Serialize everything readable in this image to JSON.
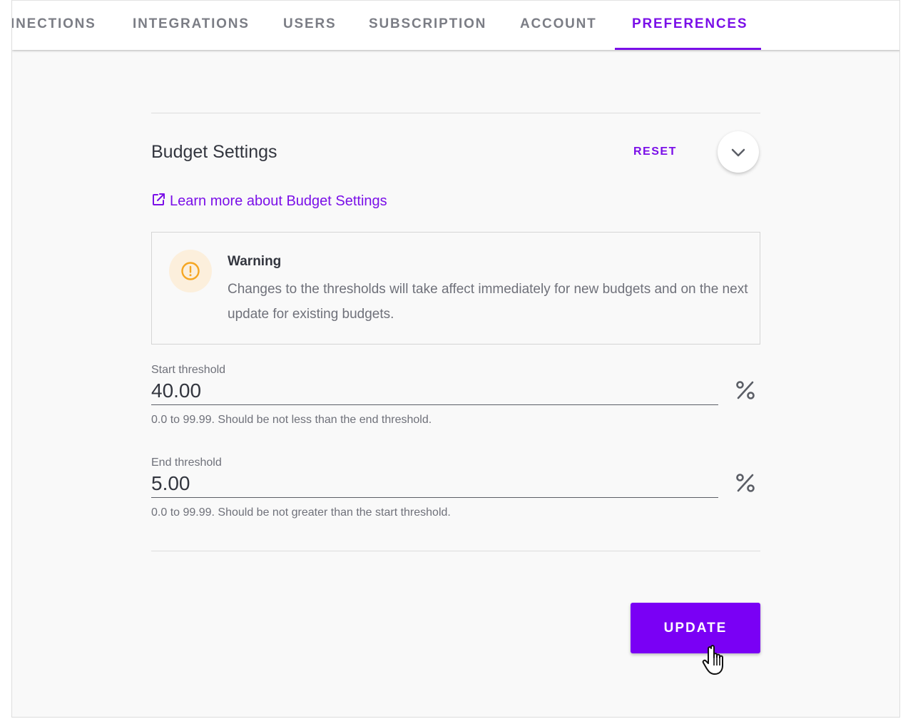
{
  "tabs": [
    {
      "label": "INECTIONS",
      "active": false
    },
    {
      "label": "INTEGRATIONS",
      "active": false
    },
    {
      "label": "USERS",
      "active": false
    },
    {
      "label": "SUBSCRIPTION",
      "active": false
    },
    {
      "label": "ACCOUNT",
      "active": false
    },
    {
      "label": "PREFERENCES",
      "active": true
    }
  ],
  "section": {
    "title": "Budget Settings",
    "reset_label": "RESET",
    "collapse_icon": "chevron-down-icon",
    "learn_more_label": "Learn more about Budget Settings",
    "learn_more_icon": "external-link-icon"
  },
  "warning": {
    "icon": "exclamation-circle-icon",
    "title": "Warning",
    "text": "Changes to the thresholds will take affect immediately for new budgets and on the next update for existing budgets."
  },
  "fields": {
    "start": {
      "label": "Start threshold",
      "value": "40.00",
      "unit_icon": "percent-icon",
      "hint": "0.0 to 99.99. Should be not less than the end threshold."
    },
    "end": {
      "label": "End threshold",
      "value": "5.00",
      "unit_icon": "percent-icon",
      "hint": "0.0 to 99.99. Should be not greater than the start threshold."
    }
  },
  "update_label": "UPDATE",
  "colors": {
    "accent": "#7a0fe8",
    "button": "#7a00f5",
    "warning_icon": "#f5a623",
    "warning_bg": "#fcefdc",
    "tab_inactive": "#7b7d85"
  }
}
